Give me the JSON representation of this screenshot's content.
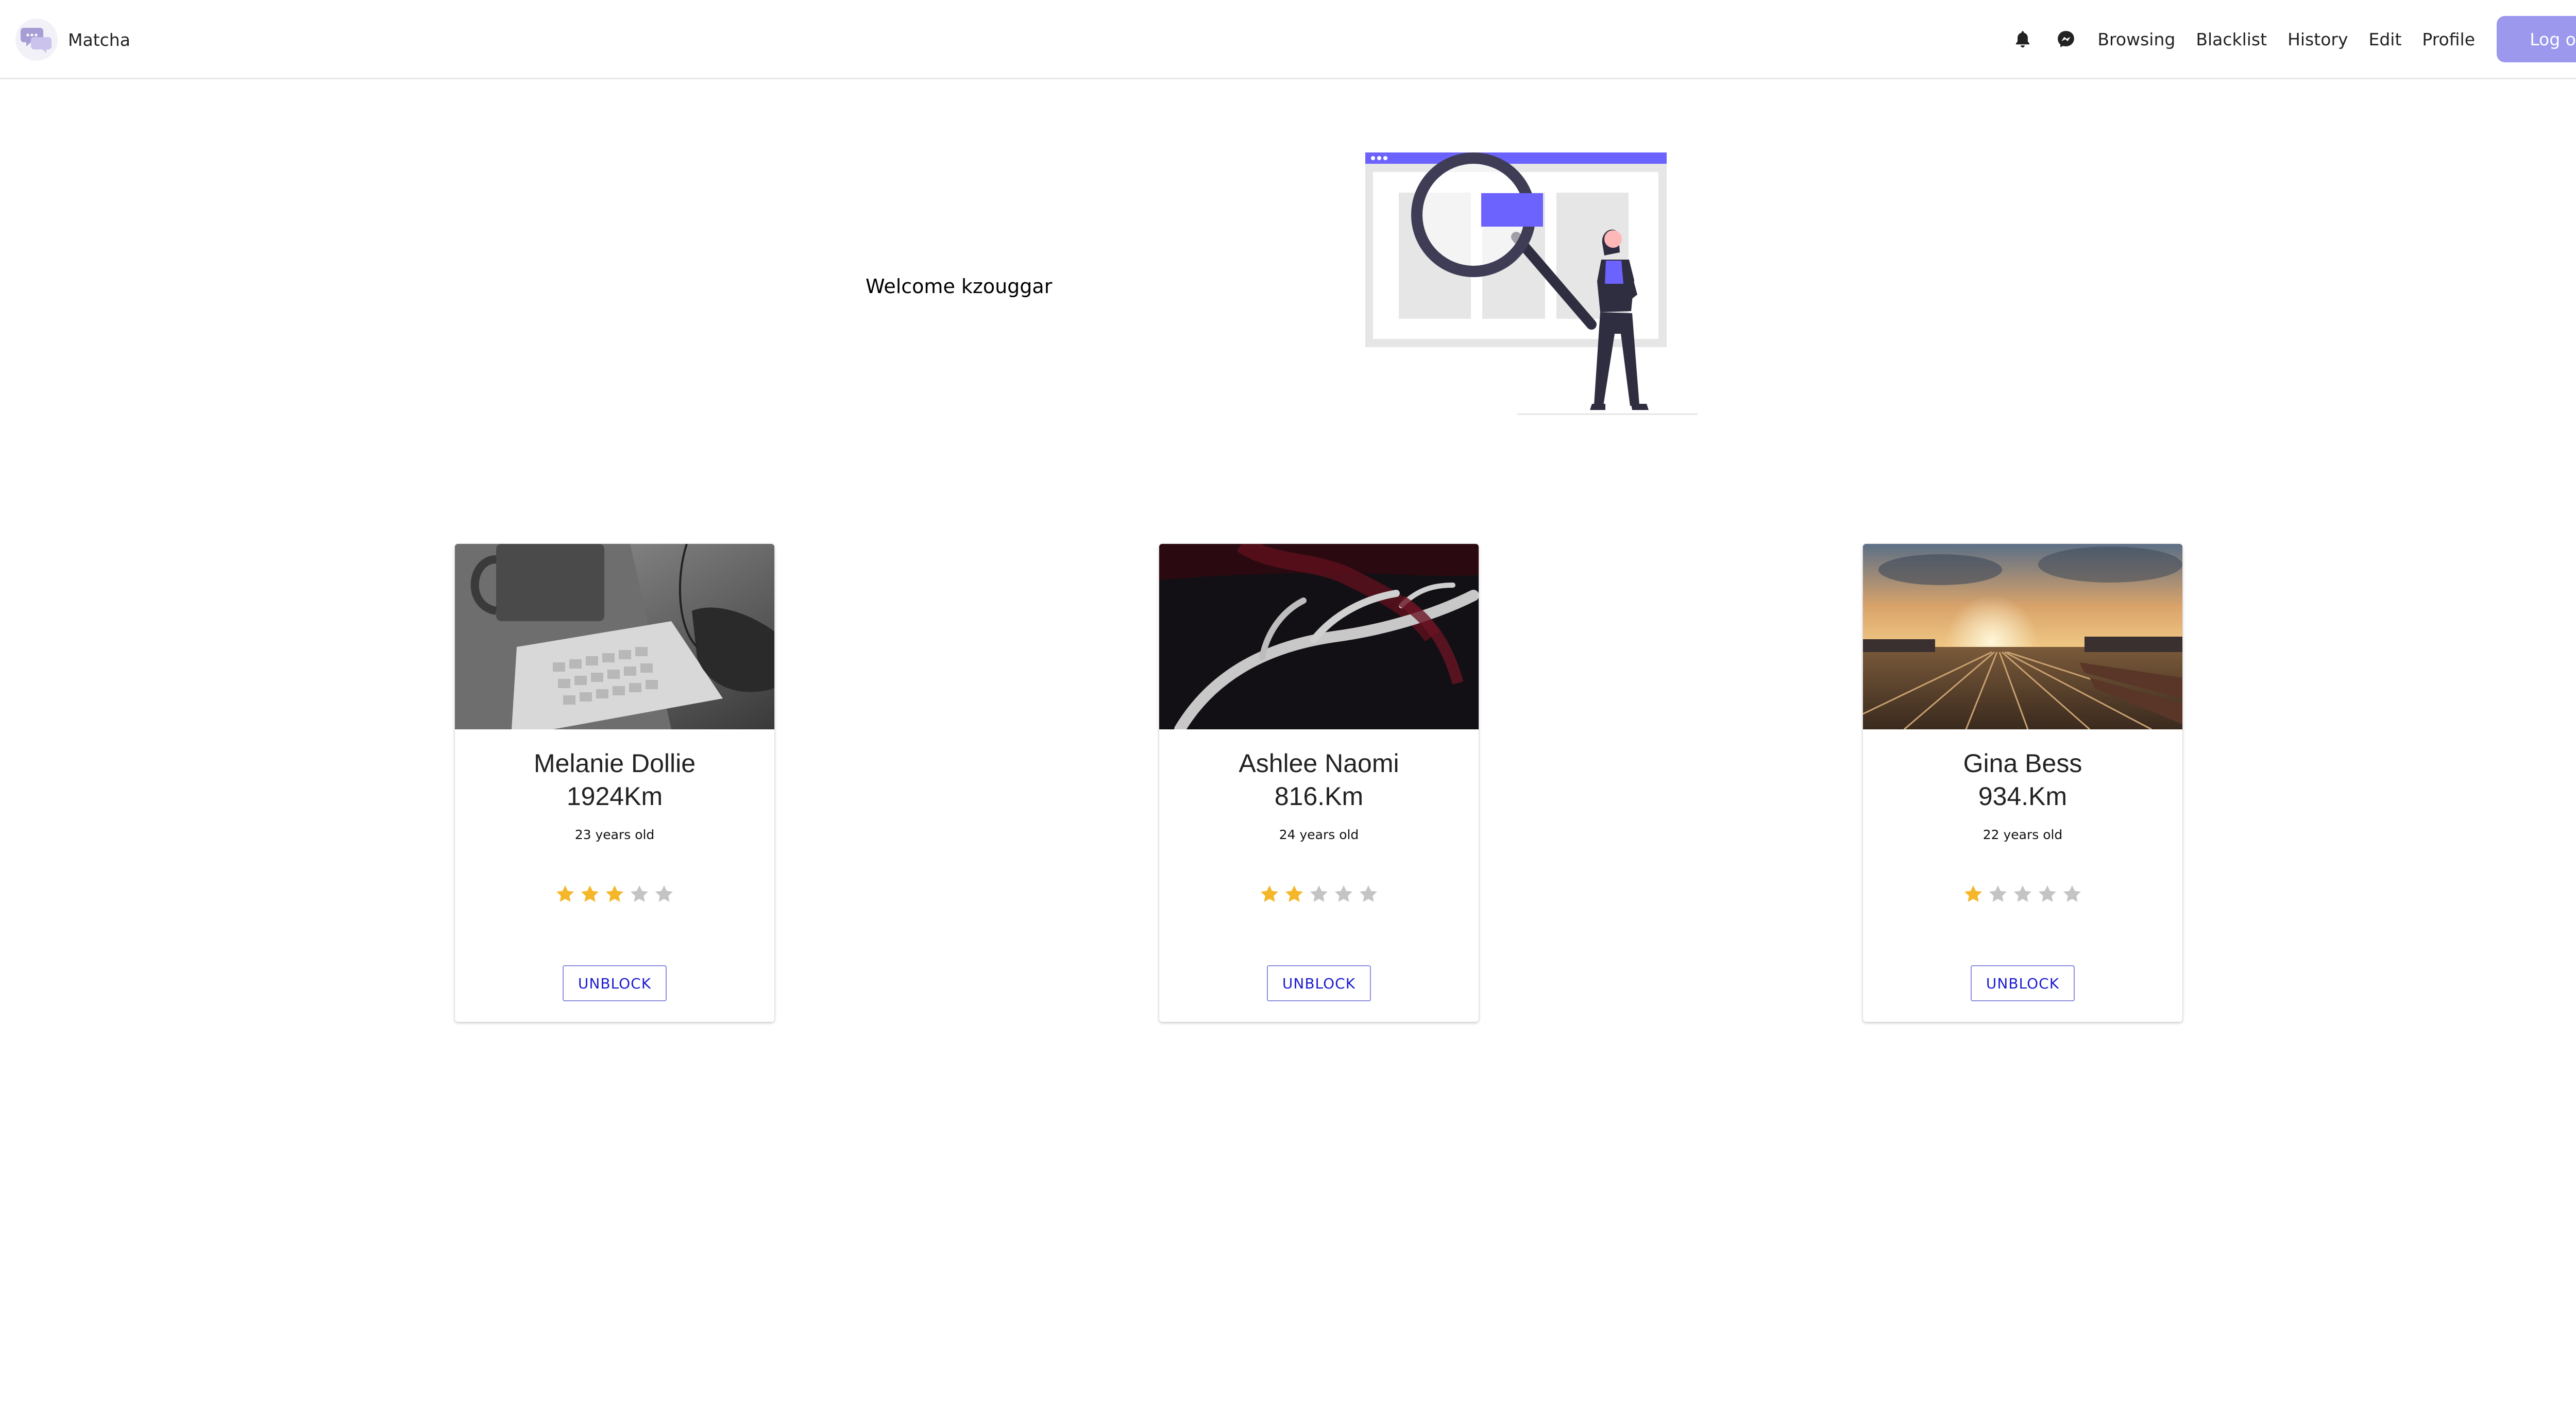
{
  "nav": {
    "brand": "Matcha",
    "links": [
      "Browsing",
      "Blacklist",
      "History",
      "Edit",
      "Profile"
    ],
    "logout_label": "Log out",
    "icons": [
      "bell-icon",
      "messenger-icon"
    ]
  },
  "hero": {
    "welcome_text": "Welcome kzouggar"
  },
  "cards": [
    {
      "name": "Melanie Dollie",
      "distance": "1924Km",
      "age": "23 years old",
      "rating": 3,
      "max_rating": 5,
      "button": "UNBLOCK",
      "photo": "keyboard-photo"
    },
    {
      "name": "Ashlee Naomi",
      "distance": "816.Km",
      "age": "24 years old",
      "rating": 2,
      "max_rating": 5,
      "button": "UNBLOCK",
      "photo": "antler-photo"
    },
    {
      "name": "Gina Bess",
      "distance": "934.Km",
      "age": "22 years old",
      "rating": 1,
      "max_rating": 5,
      "button": "UNBLOCK",
      "photo": "railyard-sunset-photo"
    }
  ],
  "colors": {
    "accent": "#6c63ff",
    "logout_bg": "#9b98ee",
    "star_filled": "#f5b72a",
    "star_empty": "#c4c4c4",
    "button_text": "#1c1ccf"
  }
}
